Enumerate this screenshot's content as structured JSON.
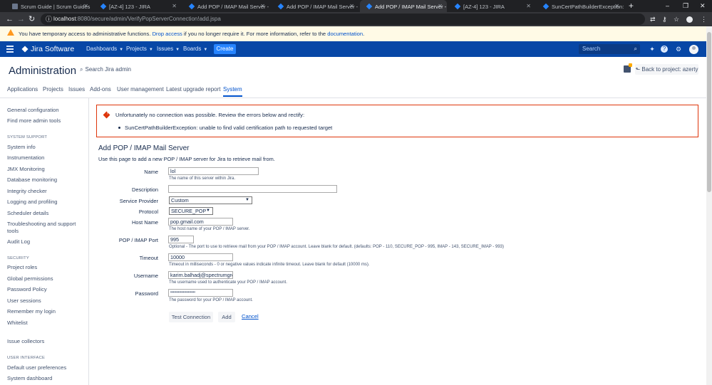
{
  "browser": {
    "tabs": [
      {
        "title": "Scrum Guide | Scrum Guides",
        "icon": "scrum-guide-favicon"
      },
      {
        "title": "[AZ-4] 123 - JIRA",
        "icon": "jira-favicon"
      },
      {
        "title": "Add POP / IMAP Mail Server - JIR",
        "icon": "jira-favicon"
      },
      {
        "title": "Add POP / IMAP Mail Server - JIR",
        "icon": "jira-favicon"
      },
      {
        "title": "Add POP / IMAP Mail Server - JIR",
        "icon": "jira-favicon",
        "active": true
      },
      {
        "title": "[AZ-4] 123 - JIRA",
        "icon": "jira-favicon"
      },
      {
        "title": "SunCertPathBuilderException: un",
        "icon": "jira-favicon"
      }
    ],
    "new_tab": "+",
    "window_controls": [
      "–",
      "❐",
      "✕"
    ],
    "url_host": "localhost",
    "url_rest": ":8080/secure/admin/VerifyPopServerConnection!add.jspa"
  },
  "banner": {
    "text_before": "You have temporary access to administrative functions.",
    "link_drop": "Drop access",
    "text_middle": "if you no longer require it. For more information, refer to the",
    "link_docs": "documentation",
    "text_after": "."
  },
  "header": {
    "product": "Jira Software",
    "nav": [
      "Dashboards",
      "Projects",
      "Issues",
      "Boards"
    ],
    "create": "Create",
    "search_placeholder": "Search"
  },
  "admin": {
    "title": "Administration",
    "search": "Search Jira admin",
    "back": "Back to project: azerty",
    "tabs": [
      "Applications",
      "Projects",
      "Issues",
      "Add-ons",
      "User management",
      "Latest upgrade report",
      "System"
    ]
  },
  "sidebar": {
    "top_items": [
      "General configuration",
      "Find more admin tools"
    ],
    "system_support_heading": "SYSTEM SUPPORT",
    "system_support": [
      "System info",
      "Instrumentation",
      "JMX Monitoring",
      "Database monitoring",
      "Integrity checker",
      "Logging and profiling",
      "Scheduler details",
      "Troubleshooting and support tools",
      "Audit Log"
    ],
    "security_heading": "SECURITY",
    "security": [
      "Project roles",
      "Global permissions",
      "Password Policy",
      "User sessions",
      "Remember my login",
      "Whitelist"
    ],
    "misc": [
      "Issue collectors"
    ],
    "ui_heading": "USER INTERFACE",
    "ui": [
      "Default user preferences",
      "System dashboard"
    ]
  },
  "error": {
    "message": "Unfortunately no connection was possible. Review the errors below and rectify:",
    "detail": "SunCertPathBuilderException: unable to find valid certification path to requested target"
  },
  "form": {
    "title": "Add POP / IMAP Mail Server",
    "description": "Use this page to add a new POP / IMAP server for Jira to retrieve mail from.",
    "name_label": "Name",
    "name_value": "lol",
    "name_help": "The name of this server within Jira.",
    "desc_label": "Description",
    "desc_value": "",
    "provider_label": "Service Provider",
    "provider_value": "Custom",
    "protocol_label": "Protocol",
    "protocol_value": "SECURE_POP",
    "host_label": "Host Name",
    "host_value": "pop.gmail.com",
    "host_help": "The host name of your POP / IMAP server.",
    "port_label": "POP / IMAP Port",
    "port_value": "995",
    "port_help": "Optional - The port to use to retrieve mail from your POP / IMAP account. Leave blank for default. (defaults: POP - 110, SECURE_POP - 995, IMAP - 143, SECURE_IMAP - 993)",
    "timeout_label": "Timeout",
    "timeout_value": "10000",
    "timeout_help": "Timeout in milliseconds - 0 or negative values indicate infinite timeout. Leave blank for default (10000 ms).",
    "user_label": "Username",
    "user_value": "karim.balhadj@spectrumgro",
    "user_help": "The username used to authenticate your POP / IMAP account.",
    "pass_label": "Password",
    "pass_value": "••••••••••••••••••••",
    "pass_help": "The password for your POP / IMAP account.",
    "test_btn": "Test Connection",
    "add_btn": "Add",
    "cancel": "Cancel"
  }
}
